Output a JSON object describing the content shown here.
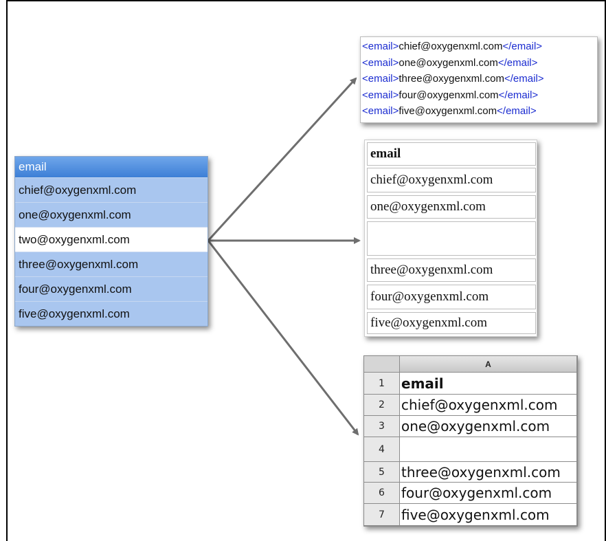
{
  "source": {
    "header": "email",
    "rows": [
      {
        "text": "chief@oxygenxml.com",
        "highlighted": true
      },
      {
        "text": "one@oxygenxml.com",
        "highlighted": true
      },
      {
        "text": "two@oxygenxml.com",
        "highlighted": false
      },
      {
        "text": "three@oxygenxml.com",
        "highlighted": true
      },
      {
        "text": "four@oxygenxml.com",
        "highlighted": true
      },
      {
        "text": "five@oxygenxml.com",
        "highlighted": true
      }
    ]
  },
  "xml": {
    "open_tag": "<email>",
    "close_tag": "</email>",
    "lines": [
      "chief@oxygenxml.com",
      "one@oxygenxml.com",
      "three@oxygenxml.com",
      "four@oxygenxml.com",
      "five@oxygenxml.com"
    ]
  },
  "html_table": {
    "header": "email",
    "cells": [
      "chief@oxygenxml.com",
      "one@oxygenxml.com",
      "",
      "three@oxygenxml.com",
      "four@oxygenxml.com",
      "five@oxygenxml.com"
    ]
  },
  "spreadsheet": {
    "column": "A",
    "rows": [
      {
        "num": "1",
        "value": "email"
      },
      {
        "num": "2",
        "value": "chief@oxygenxml.com"
      },
      {
        "num": "3",
        "value": "one@oxygenxml.com"
      },
      {
        "num": "4",
        "value": ""
      },
      {
        "num": "5",
        "value": "three@oxygenxml.com"
      },
      {
        "num": "6",
        "value": "four@oxygenxml.com"
      },
      {
        "num": "7",
        "value": "five@oxygenxml.com"
      }
    ]
  },
  "colors": {
    "selection": "#a9c6ef",
    "header": "#3d7fd6",
    "xml_tag": "#1a2bd0",
    "arrow": "#6e6e6e"
  }
}
